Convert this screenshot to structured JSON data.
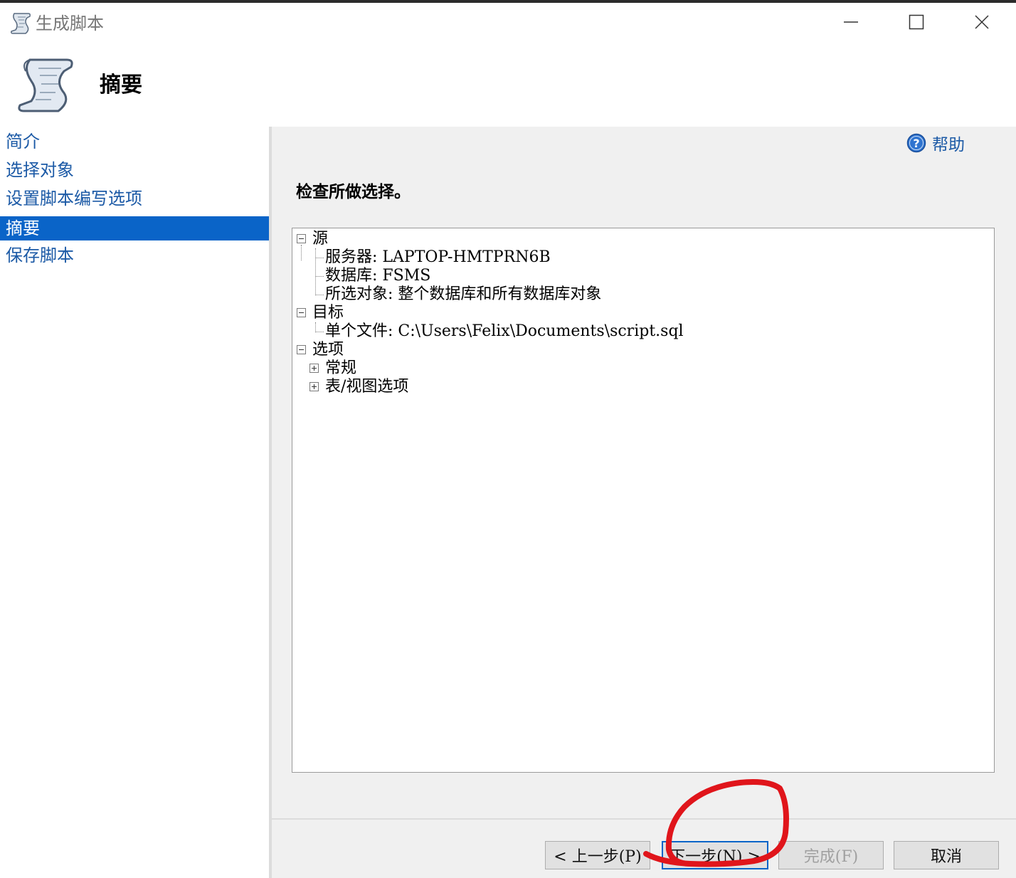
{
  "window": {
    "title": "生成脚本",
    "icon": "script-scroll-icon"
  },
  "header": {
    "title": "摘要",
    "icon": "script-scroll-icon"
  },
  "nav": {
    "items": [
      {
        "label": "简介",
        "active": false
      },
      {
        "label": "选择对象",
        "active": false
      },
      {
        "label": "设置脚本编写选项",
        "active": false
      },
      {
        "label": "摘要",
        "active": true
      },
      {
        "label": "保存脚本",
        "active": false
      }
    ]
  },
  "content": {
    "help_label": "帮助",
    "review_title": "检查所做选择。",
    "tree": {
      "source": {
        "label": "源",
        "children": [
          "服务器: LAPTOP-HMTPRN6B",
          "数据库: FSMS",
          "所选对象: 整个数据库和所有数据库对象"
        ]
      },
      "target": {
        "label": "目标",
        "children": [
          "单个文件: C:\\Users\\Felix\\Documents\\script.sql"
        ]
      },
      "options": {
        "label": "选项",
        "children": [
          "常规",
          "表/视图选项"
        ]
      }
    }
  },
  "footer": {
    "prev_label": "< 上一步(P)",
    "next_label": "下一步(N) >",
    "finish_label": "完成(F)",
    "cancel_label": "取消"
  },
  "colors": {
    "accent": "#0a64c8",
    "link": "#1c5aa6",
    "annotation": "#e0151b"
  }
}
